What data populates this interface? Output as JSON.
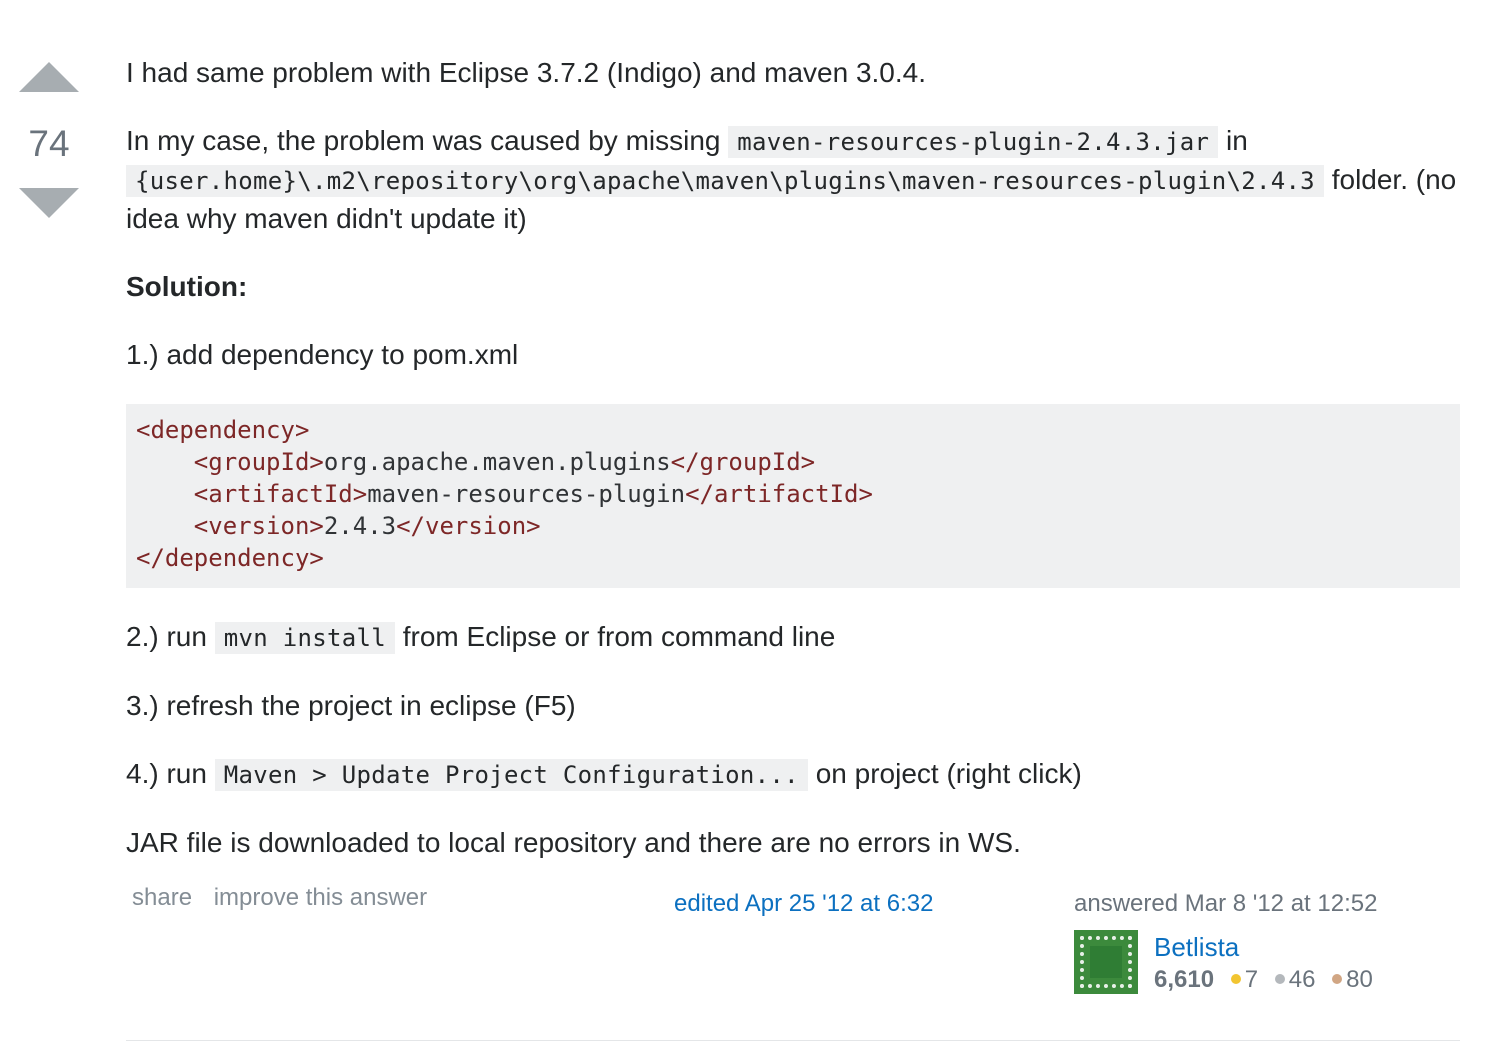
{
  "vote": {
    "count": "74"
  },
  "post": {
    "p1": "I had same problem with Eclipse 3.7.2 (Indigo) and maven 3.0.4.",
    "p2_before": "In my case, the problem was caused by missing ",
    "p2_code1": "maven-resources-plugin-2.4.3.jar",
    "p2_mid": " in ",
    "p2_code2": "{user.home}\\.m2\\repository\\org\\apache\\maven\\plugins\\maven-resources-plugin\\2.4.3",
    "p2_after": " folder. (no idea why maven didn't update it)",
    "solution_heading": "Solution:",
    "step1": "1.) add dependency to pom.xml",
    "code": {
      "dep_open": "<dependency>",
      "group_open": "<groupId>",
      "group_val": "org.apache.maven.plugins",
      "group_close": "</groupId>",
      "artifact_open": "<artifactId>",
      "artifact_val": "maven-resources-plugin",
      "artifact_close": "</artifactId>",
      "version_open": "<version>",
      "version_val": "2.4.3",
      "version_close": "</version>",
      "dep_close": "</dependency>"
    },
    "step2_before": "2.) run ",
    "step2_code": "mvn install",
    "step2_after": " from Eclipse or from command line",
    "step3": "3.) refresh the project in eclipse (F5)",
    "step4_before": "4.) run ",
    "step4_code": "Maven > Update Project Configuration...",
    "step4_after": " on project (right click)",
    "conclusion": "JAR file is downloaded to local repository and there are no errors in WS."
  },
  "menu": {
    "share": "share",
    "improve": "improve this answer"
  },
  "edited": "edited Apr 25 '12 at 6:32",
  "signature": {
    "action": "answered Mar 8 '12 at 12:52",
    "user_name": "Betlista",
    "reputation": "6,610",
    "gold": "7",
    "silver": "46",
    "bronze": "80"
  }
}
